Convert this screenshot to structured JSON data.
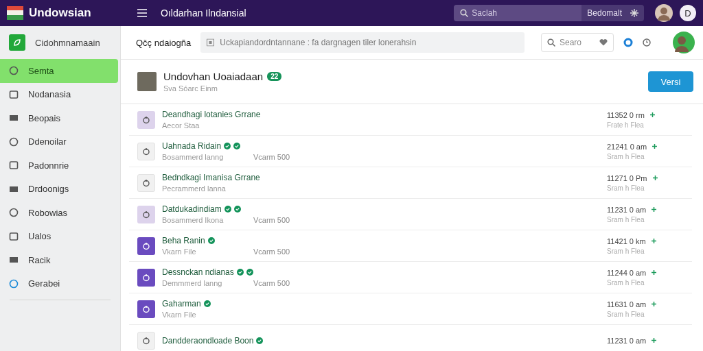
{
  "topbar": {
    "app_name": "Undowsian",
    "title": "Oıldarhan Ilndansial",
    "search": {
      "placeholder": "Saclah"
    },
    "search_action": "Bedomalt",
    "user_initial": "D"
  },
  "sidebar": {
    "header": "Cidohmnamaain",
    "items": [
      {
        "label": "Semta",
        "selected": true
      },
      {
        "label": "Nodanasia",
        "selected": false
      },
      {
        "label": "Beopais",
        "selected": false
      },
      {
        "label": "Ddenoilar",
        "selected": false
      },
      {
        "label": "Padonnrie",
        "selected": false
      },
      {
        "label": "Drdoonigs",
        "selected": false
      },
      {
        "label": "Robowias",
        "selected": false
      },
      {
        "label": "Ualos",
        "selected": false
      },
      {
        "label": "Racik",
        "selected": false
      },
      {
        "label": "Gerabei",
        "selected": false
      }
    ]
  },
  "toolbar": {
    "label": "Qčç ndaiogña",
    "filter": {
      "placeholder": "Uckapiandordntannane : fa dargnagen tiler lonerahsin"
    },
    "search": {
      "placeholder": "Searo"
    }
  },
  "header": {
    "name": "Undovhan Uoaiadaan",
    "badge": "22",
    "subtitle": "Sva Sóarc Einm",
    "button": "Versi"
  },
  "rows": [
    {
      "kind": "light",
      "title": "Deandhagi lotanies Grrane",
      "subtitle": "Aecor Staa",
      "time": "11352 0 rm",
      "note": "Frate h Flea"
    },
    {
      "kind": "plain",
      "title": "Uahnada Ridain",
      "badges": [
        {
          "kind": "check"
        },
        {
          "kind": "check"
        }
      ],
      "subtitle": "Bosammerd lanng",
      "extra": "Vcarm 500",
      "time": "21241 0 am",
      "note": "Sram h Flea"
    },
    {
      "kind": "plain",
      "title": "Bedndkagi Imanisa Grrane",
      "subtitle": "Pecrammerd lanna",
      "time": "11271 0 Pm",
      "note": "Sram h Flea"
    },
    {
      "kind": "light",
      "title": "Datdukadindiam",
      "badges": [
        {
          "kind": "check"
        },
        {
          "kind": "check"
        }
      ],
      "subtitle": "Bosammerd Ikona",
      "extra": "Vcarm 500",
      "time": "11231 0 am",
      "note": "Sram h Flea"
    },
    {
      "kind": "solid",
      "title": "Beha Ranin",
      "badges": [
        {
          "kind": "check"
        }
      ],
      "subtitle": "Vkarn File",
      "extra": "Vcarm 500",
      "time": "11421 0 km",
      "note": "Sram h Flea"
    },
    {
      "kind": "solid",
      "title": "Dessnckan ndianas",
      "badges": [
        {
          "kind": "check"
        },
        {
          "kind": "check"
        }
      ],
      "subtitle": "Demmmerd lanng",
      "extra": "Vcarm 500",
      "time": "11244 0 am",
      "note": "Sram h Flea"
    },
    {
      "kind": "solid",
      "title": "Gaharman",
      "badges": [
        {
          "kind": "check"
        }
      ],
      "subtitle": "Vkarn File",
      "time": "11631 0 am",
      "note": "Sram h Flea"
    },
    {
      "kind": "plain",
      "title": "Dandderaondloade Boon",
      "badges": [
        {
          "kind": "check"
        }
      ],
      "time": "11231 0 am"
    }
  ]
}
